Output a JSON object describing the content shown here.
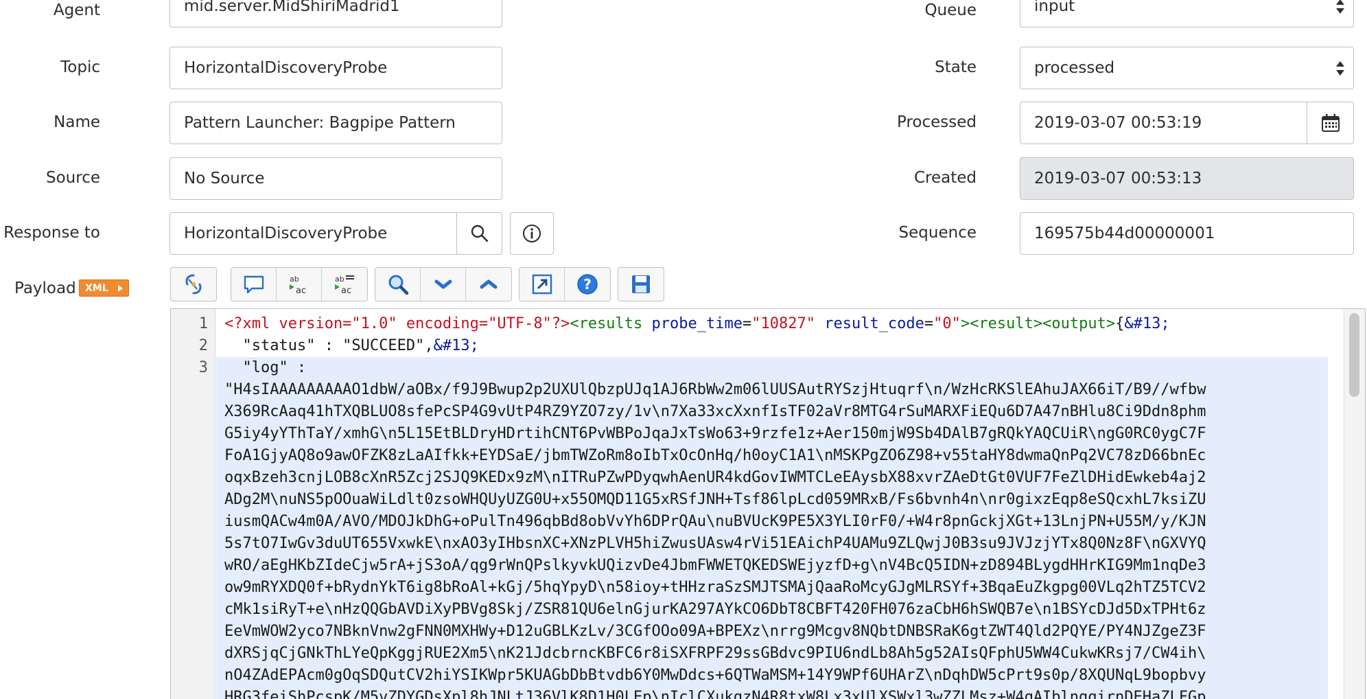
{
  "form": {
    "left": [
      {
        "label": "Agent",
        "value": "mid.server.MidShiriMadrid1"
      },
      {
        "label": "Topic",
        "value": "HorizontalDiscoveryProbe"
      },
      {
        "label": "Name",
        "value": "Pattern Launcher: Bagpipe Pattern"
      },
      {
        "label": "Source",
        "value": "No Source"
      },
      {
        "label": "Response to",
        "value": "HorizontalDiscoveryProbe"
      }
    ],
    "right": [
      {
        "label": "Queue",
        "value": "input"
      },
      {
        "label": "State",
        "value": "processed"
      },
      {
        "label": "Processed",
        "value": "2019-03-07 00:53:19"
      },
      {
        "label": "Created",
        "value": "2019-03-07 00:53:13"
      },
      {
        "label": "Sequence",
        "value": "169575b44d00000001"
      }
    ]
  },
  "payload": {
    "label": "Payload",
    "badge": "XML",
    "toolbar": [
      "format-icon",
      "comment-icon",
      "replace-icon",
      "replace-all-icon",
      "search-icon",
      "collapse-icon",
      "expand-icon",
      "fullscreen-icon",
      "help-icon",
      "save-icon"
    ]
  },
  "editor": {
    "line_numbers": [
      "1",
      "2",
      "3"
    ],
    "line1": {
      "pi": "<?xml version=\"1.0\" encoding=\"UTF-8\"?>",
      "tag_open": "<results",
      "attr1": "probe_time",
      "eq1": "=",
      "val1": "\"10827\"",
      "attr2": "result_code",
      "eq2": "=",
      "val2": "\"0\"",
      "tag_close": "><result><output>",
      "brace": "{",
      "entity": "&#13;"
    },
    "line2": {
      "key": "  \"status\" : \"SUCCEED\",",
      "entity": "&#13;"
    },
    "line3": "  \"log\" :",
    "log_rows": [
      "\"H4sIAAAAAAAAAO1dbW/aOBx/f9J9Bwup2p2UXUlQbzpUJq1AJ6RbWw2m06lUUSAutRYSzjHtuqrf\\n/WzHcRKSlEAhuJAX66iT/B9//wfbw",
      "X369RcAaq41hTXQBLUO8sfePcSP4G9vUtP4RZ9YZO7zy/1v\\n7Xa33xcXxnfIsTF02aVr8MTG4rSuMARXFiEQu6D7A47nBHlu8Ci9Ddn8phm",
      "G5iy4yYThTaY/xmhG\\n5L15EtBLDryHDrtihCNT6PvWBPoJqaJxTsWo63+9rzfe1z+Aer150mjW9Sb4DAlB7gRQkYAQCUiR\\ngG0RC0ygC7F",
      "FoA1GjyAQ8o9awOFZK8zLaAIfkk+EYDSaE/jbmTWZoRm8oIbTxOcOnHq/h0oyC1A1\\nMSKPgZO6Z98+v55taHY8dwmaQnPq2VC78zD66bnEc",
      "oqxBzeh3cnjLOB8cXnR5Zcj2SJQ9KEDx9zM\\nITRuPZwPDyqwhAenUR4kdGovIWMTCLeEAysbX88xvrZAeDtGt0VUF7FeZlDHidEwkeb4aj2",
      "ADg2M\\nuNS5pOOuaWiLdlt0zsoWHQUyUZG0U+x55OMQD11G5xRSfJNH+Tsf86lpLcd059MRxB/Fs6bvnh4n\\nr0gixzEqp8eSQcxhL7ksiZU",
      "iusmQACw4m0A/AVO/MDOJkDhG+oPulTn496qbBd8obVvYh6DPrQAu\\nuBVUcK9PE5X3YLI0rF0/+W4r8pnGckjXGt+13LnjPN+U55M/y/KJN",
      "5s7tO7IwGv3duUT655VxwkE\\nxAO3yIHbsnXC+XNzPLVH5hiZwusUAsw4rVi51EAichP4UAMu9ZLQwjJ0B3su9JVJzjYTx8Q0Nz8F\\nGXVYQ",
      "wRO/aEgHKbZIdeCjw5rA+jS3oA/qg9rWnQPslkyvkUQizvDe4JbmFWWETQKEDSWEjyzfD+g\\nV4BcQ5IDN+zD894BLygdHHrKIG9Mm1nqDe3",
      "ow9mRYXDQ0f+bRydnYkT6ig8bRoAl+kGj/5hqYpyD\\n58ioy+tHHzraSzSMJTSMAjQaaRoMcyGJgMLRSYf+3BqaEuZkgpg00VLq2hTZ5TCV2",
      "cMk1siRyT+e\\nHzQQGbAVDiXyPBVg8Skj/ZSR81QU6elnGjurKA297AYkCO6DbT8CBFT420FH076zaCbH6hSWQB7e\\n1BSYcDJd5DxTPHt6z",
      "EeVmWOW2yco7NBknVnw2gFNN0MXHWy+D12uGBLKzLv/3CGfOOo09A+BPEXz\\nrrg9Mcgv8NQbtDNBSRaK6gtZWT4Qld2PQYE/PY4NJZgeZ3F",
      "dXRSjqCjGNkThLYeQpKggjRUE2Xm5\\nK21JdcbrncKBFC6r8iSXFRPF29ssGBdvc9PIU6ndLb8Ah5g52AIsQFphU5WW4CukwKRsj7/CW4ih\\",
      "nO4ZAdEPAcm0gOqSDQutCV2hiYSIKWpr5KUAGbDbBtvdb6Y0MwDdcs+6QTWaMSM+14Y9WPf6UHArZ\\nDqhDW5cPrt9s0p/8XQUNqL9bopbvy",
      "HRG3feiShPcspK/M5vZDYGDsXpl8hJNLtJ36VlK8D1H0LEp\\nIclCXukqzN4R8txW8Lx3xUlXSWxl3wZZLMsz+W4qAIblngqirnDEHaZLFGp"
    ]
  }
}
